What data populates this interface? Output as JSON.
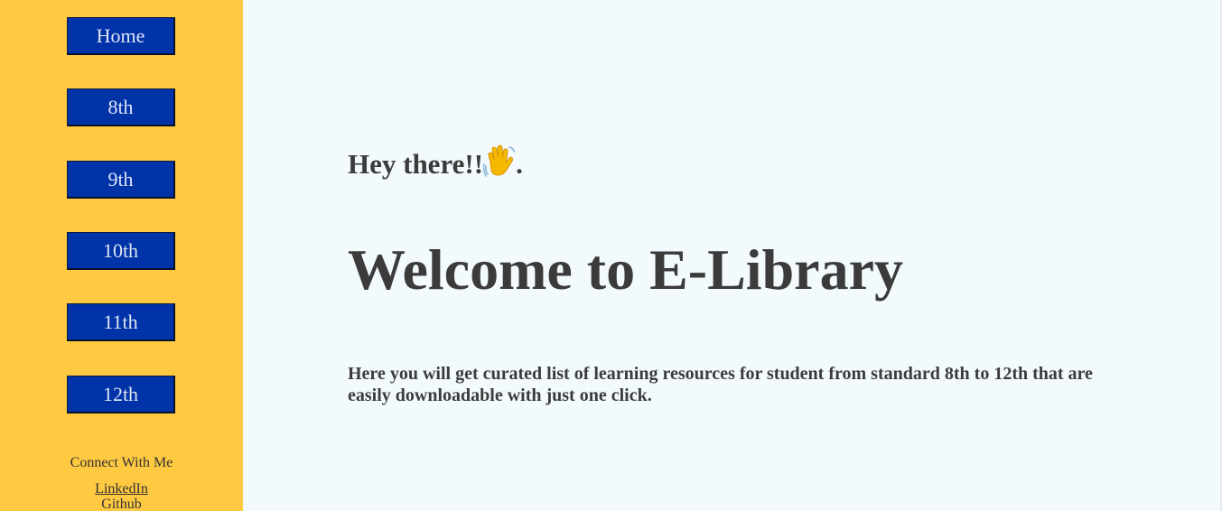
{
  "sidebar": {
    "nav": [
      {
        "label": "Home"
      },
      {
        "label": "8th"
      },
      {
        "label": "9th"
      },
      {
        "label": "10th"
      },
      {
        "label": "11th"
      },
      {
        "label": "12th"
      }
    ],
    "connect_title": "Connect With Me",
    "links": [
      {
        "label": "LinkedIn"
      },
      {
        "label": "Github"
      }
    ]
  },
  "main": {
    "greeting_text": "Hey there!!",
    "greeting_icon": "waving-hand-icon",
    "greeting_suffix": ".",
    "heading": "Welcome to E-Library",
    "description": "Here you will get curated list of learning resources for student from standard 8th to 12th that are easily downloadable with just one click."
  },
  "colors": {
    "sidebar_bg": "#ffc942",
    "button_bg": "#0032a8",
    "page_bg": "#f3fafd",
    "text": "#3b3b3b"
  }
}
